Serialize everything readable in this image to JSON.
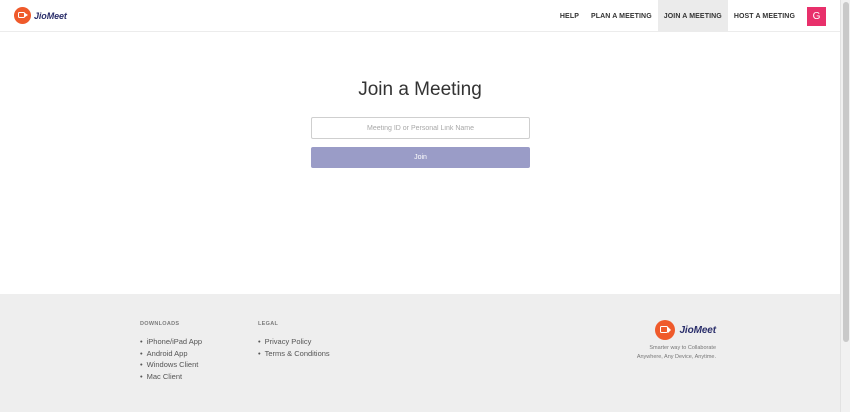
{
  "header": {
    "brand": "JioMeet",
    "nav": [
      {
        "label": "HELP"
      },
      {
        "label": "PLAN A MEETING"
      },
      {
        "label": "JOIN A MEETING",
        "active": true
      },
      {
        "label": "HOST A MEETING"
      }
    ],
    "avatar_initial": "G"
  },
  "main": {
    "title": "Join a Meeting",
    "input_placeholder": "Meeting ID or Personal Link Name",
    "input_value": "",
    "join_label": "Join"
  },
  "footer": {
    "downloads_title": "DOWNLOADS",
    "downloads": [
      "iPhone/iPad App",
      "Android App",
      "Windows Client",
      "Mac Client"
    ],
    "legal_title": "LEGAL",
    "legal": [
      "Privacy Policy",
      "Terms & Conditions"
    ],
    "brand": "JioMeet",
    "tagline": "Smarter way to Collaborate Anywhere, Any Device, Anytime."
  },
  "colors": {
    "brand_orange": "#ef5a2b",
    "brand_navy": "#2b2f6b",
    "join_button": "#9a9cc7",
    "avatar": "#e8306b"
  },
  "icons": {
    "logo": "video-camera-logo-icon"
  }
}
